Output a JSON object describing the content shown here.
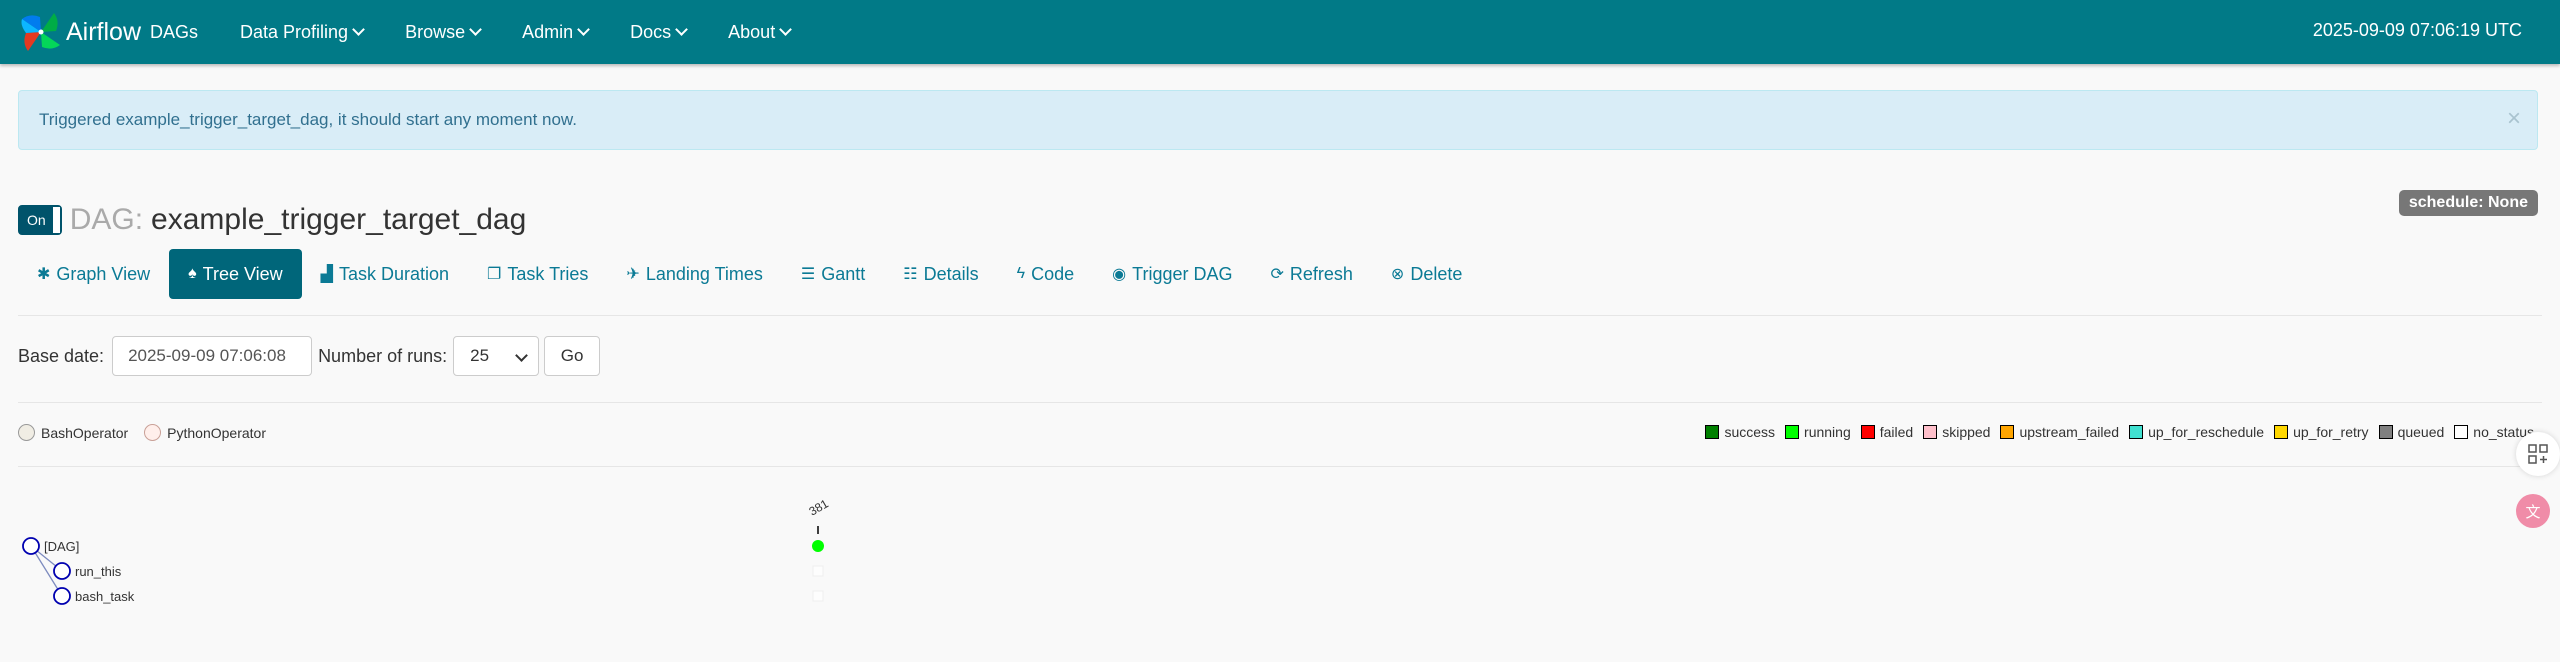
{
  "navbar": {
    "brand": "Airflow",
    "items": [
      {
        "label": "DAGs",
        "dropdown": false
      },
      {
        "label": "Data Profiling",
        "dropdown": true
      },
      {
        "label": "Browse",
        "dropdown": true
      },
      {
        "label": "Admin",
        "dropdown": true
      },
      {
        "label": "Docs",
        "dropdown": true
      },
      {
        "label": "About",
        "dropdown": true
      }
    ],
    "time": "2025-09-09 07:06:19 UTC"
  },
  "alert": {
    "message": "Triggered example_trigger_target_dag, it should start any moment now.",
    "close": "×"
  },
  "dag": {
    "toggle": "On",
    "label": "DAG:",
    "id": "example_trigger_target_dag",
    "schedule": "schedule: None"
  },
  "tabs": [
    {
      "label": "Graph View",
      "icon": "asterisk-icon",
      "glyph": "✱",
      "active": false
    },
    {
      "label": "Tree View",
      "icon": "tree-icon",
      "glyph": "♠",
      "active": true
    },
    {
      "label": "Task Duration",
      "icon": "bar-chart-icon",
      "glyph": "▟",
      "active": false
    },
    {
      "label": "Task Tries",
      "icon": "duplicate-icon",
      "glyph": "❐",
      "active": false
    },
    {
      "label": "Landing Times",
      "icon": "plane-icon",
      "glyph": "✈",
      "active": false
    },
    {
      "label": "Gantt",
      "icon": "gantt-icon",
      "glyph": "☰",
      "active": false
    },
    {
      "label": "Details",
      "icon": "list-icon",
      "glyph": "☷",
      "active": false
    },
    {
      "label": "Code",
      "icon": "flash-icon",
      "glyph": "ϟ",
      "active": false
    },
    {
      "label": "Trigger DAG",
      "icon": "play-circle-icon",
      "glyph": "◉",
      "active": false
    },
    {
      "label": "Refresh",
      "icon": "refresh-icon",
      "glyph": "⟳",
      "active": false
    },
    {
      "label": "Delete",
      "icon": "remove-circle-icon",
      "glyph": "⊗",
      "active": false
    }
  ],
  "form": {
    "base_date_label": "Base date:",
    "base_date_value": "2025-09-09 07:06:08",
    "num_runs_label": "Number of runs:",
    "num_runs_value": "25",
    "go_label": "Go"
  },
  "operators": [
    {
      "label": "BashOperator",
      "color": "#f0ede4",
      "border": "#999"
    },
    {
      "label": "PythonOperator",
      "color": "#ffefeb",
      "border": "#c9a097"
    }
  ],
  "states": [
    {
      "label": "success",
      "color": "#008000"
    },
    {
      "label": "running",
      "color": "#00ff00"
    },
    {
      "label": "failed",
      "color": "#ff0000"
    },
    {
      "label": "skipped",
      "color": "#ffc0cb"
    },
    {
      "label": "upstream_failed",
      "color": "#ffa500"
    },
    {
      "label": "up_for_reschedule",
      "color": "#40e0d0"
    },
    {
      "label": "up_for_retry",
      "color": "#ffd700"
    },
    {
      "label": "queued",
      "color": "#808080"
    },
    {
      "label": "no_status",
      "color": "#ffffff"
    }
  ],
  "tree": {
    "nodes": [
      {
        "label": "[DAG]",
        "level": 0
      },
      {
        "label": "run_this",
        "level": 1
      },
      {
        "label": "bash_task",
        "level": 1
      }
    ],
    "run_label": "381",
    "run_state_color": "#00ff00"
  },
  "side": {
    "apps_icon": "apps-icon",
    "translate_icon": "translate-icon",
    "translate_glyph": "文"
  }
}
